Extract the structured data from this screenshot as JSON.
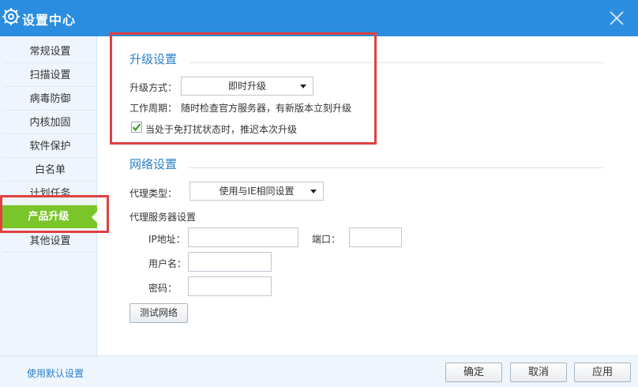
{
  "window": {
    "title": "设置中心"
  },
  "sidebar": {
    "items": [
      {
        "label": "常规设置"
      },
      {
        "label": "扫描设置"
      },
      {
        "label": "病毒防御"
      },
      {
        "label": "内核加固"
      },
      {
        "label": "软件保护"
      },
      {
        "label": "白名单"
      },
      {
        "label": "计划任务"
      },
      {
        "label": "产品升级",
        "active": true
      },
      {
        "label": "其他设置"
      }
    ]
  },
  "upgrade": {
    "section_title": "升级设置",
    "mode_label": "升级方式：",
    "mode_value": "即时升级",
    "cycle_label": "工作周期：",
    "cycle_value": "随时检查官方服务器，有新版本立刻升级",
    "defer_checked": true,
    "defer_label": "当处于免打扰状态时，推迟本次升级"
  },
  "network": {
    "section_title": "网络设置",
    "proxy_type_label": "代理类型：",
    "proxy_type_value": "使用与IE相同设置",
    "proxy_server_label": "代理服务器设置",
    "ip_label": "IP地址：",
    "ip_value": "",
    "port_label": "端口：",
    "port_value": "",
    "user_label": "用户名：",
    "user_value": "",
    "password_label": "密码：",
    "password_value": "",
    "test_button": "测试网络"
  },
  "footer": {
    "default_link": "使用默认设置",
    "ok": "确定",
    "cancel": "取消",
    "apply": "应用"
  },
  "colors": {
    "titlebar": "#2a8de0",
    "sidebar_bg": "#eef5fc",
    "active_item": "#7ac52a",
    "section_title": "#2a7fc8",
    "highlight_box": "#e04040"
  }
}
